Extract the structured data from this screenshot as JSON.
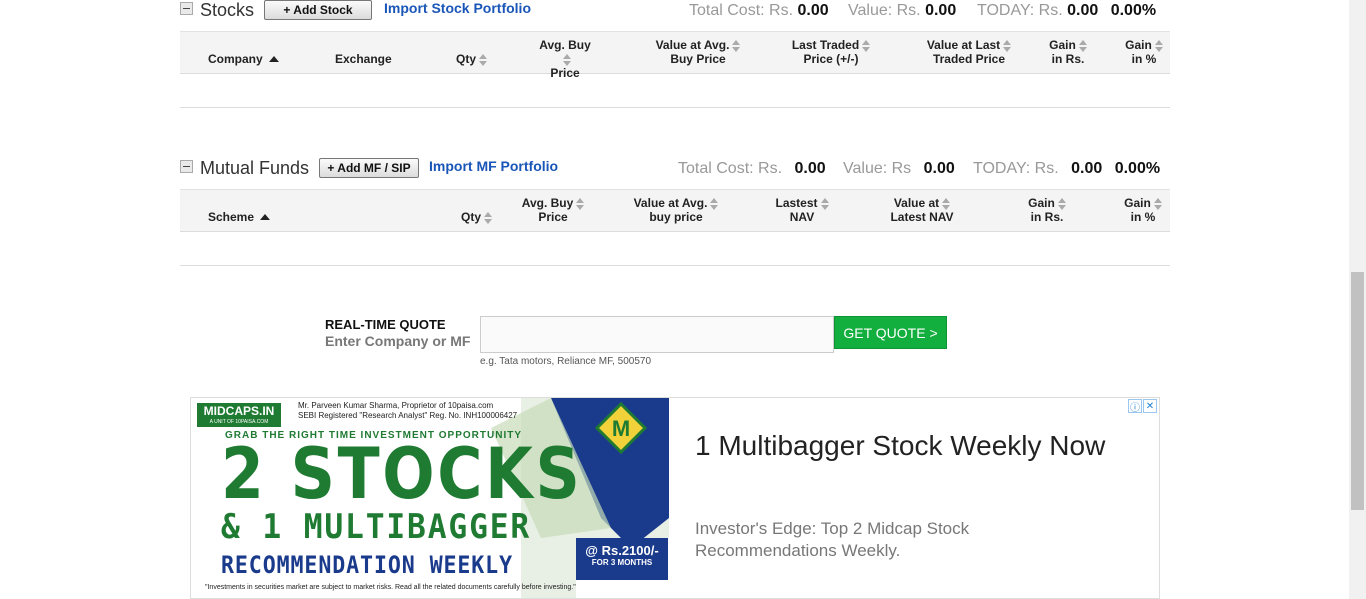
{
  "stocks": {
    "title": "Stocks",
    "add_button": "+ Add Stock",
    "import_link": "Import Stock Portfolio",
    "total_cost_label": "Total Cost: Rs.",
    "total_cost_value": "0.00",
    "value_label": "Value: Rs.",
    "value_value": "0.00",
    "today_label": "TODAY: Rs.",
    "today_value": "0.00",
    "today_pct": "0.00%",
    "columns": {
      "company": "Company",
      "exchange": "Exchange",
      "qty": "Qty",
      "avg_buy_1": "Avg. Buy",
      "avg_buy_2": "Price",
      "value_avg_1": "Value at Avg.",
      "value_avg_2": "Buy Price",
      "last_traded_1": "Last Traded",
      "last_traded_2": "Price (+/-)",
      "value_last_1": "Value at Last",
      "value_last_2": "Traded Price",
      "gain_rs_1": "Gain",
      "gain_rs_2": "in Rs.",
      "gain_pct_1": "Gain",
      "gain_pct_2": "in %"
    }
  },
  "mutual_funds": {
    "title": "Mutual Funds",
    "add_button": "+ Add MF / SIP",
    "import_link": "Import MF Portfolio",
    "total_cost_label": "Total Cost: Rs.",
    "total_cost_value": "0.00",
    "value_label": "Value: Rs",
    "value_value": "0.00",
    "today_label": "TODAY: Rs.",
    "today_value": "0.00",
    "today_pct": "0.00%",
    "columns": {
      "scheme": "Scheme",
      "qty": "Qty",
      "avg_buy_1": "Avg. Buy",
      "avg_buy_2": "Price",
      "value_avg_1": "Value at Avg.",
      "value_avg_2": "buy price",
      "latest_nav_1": "Lastest",
      "latest_nav_2": "NAV",
      "value_latest_1": "Value at",
      "value_latest_2": "Latest NAV",
      "gain_rs_1": "Gain",
      "gain_rs_2": "in Rs.",
      "gain_pct_1": "Gain",
      "gain_pct_2": "in %"
    }
  },
  "quote": {
    "title": "REAL-TIME QUOTE",
    "subtitle": "Enter Company or MF",
    "input_value": "",
    "button": "GET QUOTE >",
    "hint": "e.g. Tata motors, Reliance MF, 500570"
  },
  "ad": {
    "logo": "MIDCAPS.IN",
    "logo_sub": "A UNIT OF 10PAISA.COM",
    "proprietor": "Mr. Parveen Kumar Sharma, Proprietor of 10paisa.com",
    "sebi": "SEBI Registered \"Research Analyst\" Reg. No. INH100006427",
    "grab": "GRAB THE RIGHT TIME INVESTMENT OPPORTUNITY",
    "big_line": "2 STOCKS",
    "mid_line": "& 1 MULTIBAGGER",
    "rec_line": "RECOMMENDATION WEEKLY",
    "price": "@ Rs.2100/-",
    "price_period": "FOR 3 MONTHS",
    "disclaimer": "\"Investments in securities market are subject to market risks. Read all the related documents carefully before investing.\"",
    "badge_letter": "M",
    "headline": "1 Multibagger Stock Weekly Now",
    "description": "Investor's Edge: Top 2 Midcap Stock Recommendations Weekly.",
    "info_icon": "ⓘ",
    "close_icon": "✕"
  },
  "colors": {
    "link": "#1a56b8",
    "quote_button": "#12ae3e",
    "ad_green": "#1f7a32",
    "ad_blue": "#1a3a8c"
  }
}
